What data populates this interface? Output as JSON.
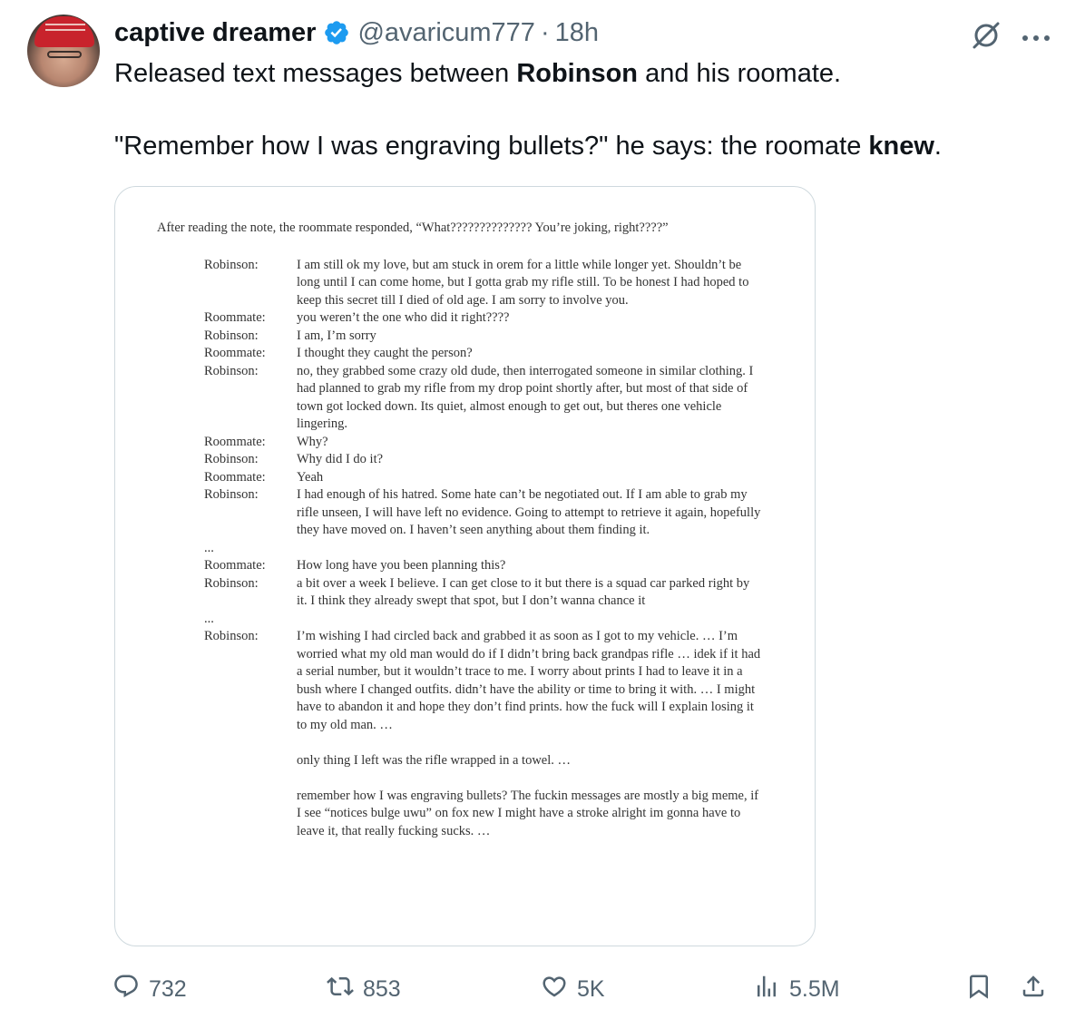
{
  "author": {
    "display_name": "captive dreamer",
    "handle": "@avaricum777",
    "separator": "·",
    "timestamp": "18h",
    "verified": true,
    "avatar_icon": "avatar-photo"
  },
  "tweet_text": {
    "line1": [
      {
        "text": "Released text messages between ",
        "bold": false
      },
      {
        "text": "Robinson",
        "bold": true
      },
      {
        "text": " and his roomate.",
        "bold": false
      }
    ],
    "line2": [
      {
        "text": "\"Remember how I was engraving bullets?\" he says: the roomate ",
        "bold": false
      },
      {
        "text": "knew",
        "bold": true
      },
      {
        "text": ".",
        "bold": false
      }
    ]
  },
  "document": {
    "intro": "After reading the note, the roommate responded, “What?????????????? You’re joking, right????”",
    "messages": [
      {
        "speaker": "Robinson:",
        "text": "I am still ok my love, but am stuck in orem for a little while longer yet. Shouldn’t be long until I can come home, but I gotta grab my rifle still. To be honest I had hoped to keep this secret till I died of old age. I am sorry to involve you."
      },
      {
        "speaker": "Roommate:",
        "text": "you weren’t the one who did it right????"
      },
      {
        "speaker": "Robinson:",
        "text": "I am, I’m sorry"
      },
      {
        "speaker": "Roommate:",
        "text": "I thought they caught the person?"
      },
      {
        "speaker": "Robinson:",
        "text": "no, they grabbed some crazy old dude, then interrogated someone in similar clothing. I had planned to grab my rifle from my drop point shortly after, but most of that side of town got locked down. Its quiet, almost enough to get out, but theres one vehicle lingering."
      },
      {
        "speaker": "Roommate:",
        "text": "Why?"
      },
      {
        "speaker": "Robinson:",
        "text": "Why did I do it?"
      },
      {
        "speaker": "Roommate:",
        "text": "Yeah"
      },
      {
        "speaker": "Robinson:",
        "text": "I had enough of his hatred. Some hate can’t be negotiated out. If I am able to grab my rifle unseen, I will have left no evidence. Going to attempt to retrieve it again, hopefully they have moved on. I haven’t seen anything about them finding it."
      },
      {
        "ellipsis": "..."
      },
      {
        "speaker": "Roommate:",
        "text": "How long have you been planning this?"
      },
      {
        "speaker": "Robinson:",
        "text": "a bit over a week I believe. I can get close to it but there is a squad car parked right by it. I think they already swept that spot, but I don’t wanna chance it"
      },
      {
        "ellipsis": "..."
      },
      {
        "speaker": "Robinson:",
        "text": "I’m wishing I had circled back and grabbed it as soon as I got to my vehicle. … I’m worried what my old man would do if I didn’t bring back grandpas rifle … idek if it had a serial number, but it wouldn’t trace to me. I worry about prints I had to leave it in a bush where I changed outfits. didn’t have the ability or time to bring it with. … I might have to abandon it and hope they don’t find prints. how the fuck will I explain losing it to my old man. …"
      },
      {
        "speaker": "",
        "text": "only thing I left was the rifle wrapped in a towel. …"
      },
      {
        "speaker": "",
        "text": "remember how I was engraving bullets? The fuckin messages are mostly a big meme, if I see “notices bulge uwu” on fox new I might have a stroke alright im gonna have to leave it, that really fucking sucks. …"
      }
    ]
  },
  "actions": {
    "replies": "732",
    "reposts": "853",
    "likes": "5K",
    "views": "5.5M"
  },
  "colors": {
    "text_primary": "#0f1419",
    "text_secondary": "#536471",
    "verified_blue": "#1d9bf0",
    "border": "#cfd9de"
  }
}
